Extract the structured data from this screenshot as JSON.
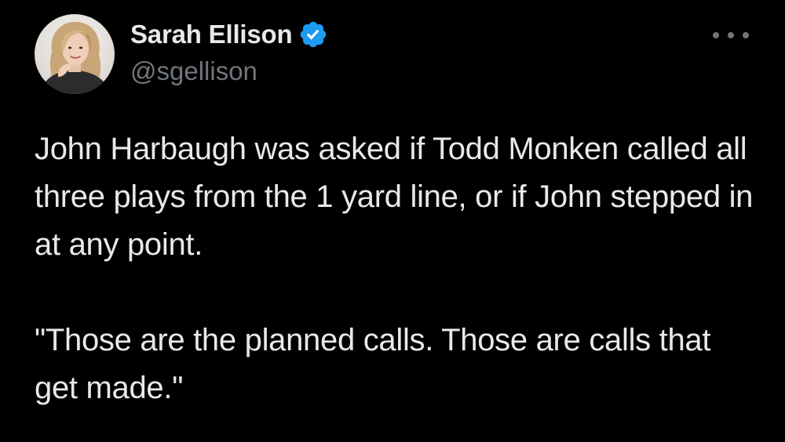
{
  "author": {
    "display_name": "Sarah Ellison",
    "handle": "@sgellison",
    "verified": true,
    "avatar_icon": "profile-photo"
  },
  "menu": {
    "icon": "more-options-icon"
  },
  "tweet": {
    "paragraphs": [
      "John Harbaugh was asked if Todd Monken called all three plays from the 1 yard line, or if John stepped in at any point.",
      "\"Those are the planned calls. Those are calls that get made.\""
    ]
  },
  "colors": {
    "background": "#000000",
    "primary_text": "#e7e9ea",
    "secondary_text": "#71767b",
    "verified_badge": "#1d9bf0"
  }
}
